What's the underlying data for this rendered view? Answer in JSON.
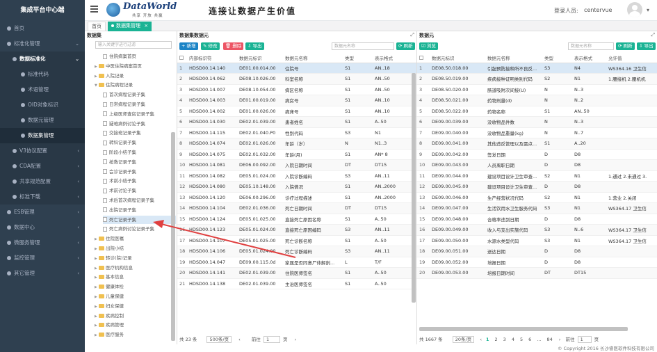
{
  "sidebar": {
    "brand": "集成平台中心端",
    "items": [
      {
        "label": "首页",
        "level": 0,
        "chev": ""
      },
      {
        "label": "标准化管理",
        "level": 0,
        "chev": "⌄"
      },
      {
        "label": "数据标准化",
        "level": 1,
        "chev": "⌄",
        "bold": true
      },
      {
        "label": "标准代码",
        "level": 2,
        "chev": ""
      },
      {
        "label": "术语管理",
        "level": 2,
        "chev": ""
      },
      {
        "label": "OID对象标识",
        "level": 2,
        "chev": ""
      },
      {
        "label": "数据元管理",
        "level": 2,
        "chev": ""
      },
      {
        "label": "数据集管理",
        "level": 2,
        "chev": "",
        "active": true
      },
      {
        "label": "V3协议配置",
        "level": 1,
        "chev": "‹"
      },
      {
        "label": "CDA配置",
        "level": 1,
        "chev": "‹"
      },
      {
        "label": "共享规范配置",
        "level": 1,
        "chev": "‹"
      },
      {
        "label": "标准下载",
        "level": 1,
        "chev": "‹"
      },
      {
        "label": "ESB管理",
        "level": 0,
        "chev": "‹"
      },
      {
        "label": "数据中心",
        "level": 0,
        "chev": "‹"
      },
      {
        "label": "微服务管理",
        "level": 0,
        "chev": "‹"
      },
      {
        "label": "监控管理",
        "level": 0,
        "chev": "‹"
      },
      {
        "label": "其它管理",
        "level": 0,
        "chev": "‹"
      }
    ]
  },
  "header": {
    "menu_icon": "hamburger-icon",
    "logo_text": "DataWorld",
    "logo_sub": "共享 开放 共赢",
    "slogan": "连接让数据产生价值",
    "login_label": "登录人员:",
    "user": "centervue",
    "caret": "▾"
  },
  "tabs": {
    "home": "首页",
    "current": "数据集管理",
    "close": "×"
  },
  "tree": {
    "title": "数据集",
    "search_placeholder": "输入关键字进行过滤",
    "nodes": [
      {
        "label": "住院病案首页",
        "type": "doc",
        "level": 2
      },
      {
        "label": "中医住院病案首页",
        "type": "folder",
        "level": 1
      },
      {
        "label": "入院记录",
        "type": "folder",
        "level": 1
      },
      {
        "label": "住院病程记录",
        "type": "folder",
        "level": 1,
        "open": true
      },
      {
        "label": "首次病程记录子集",
        "type": "doc",
        "level": 2
      },
      {
        "label": "日常病程记录子集",
        "type": "doc",
        "level": 2
      },
      {
        "label": "上级医师查房记录子集",
        "type": "doc",
        "level": 2
      },
      {
        "label": "疑难病例讨论子集",
        "type": "doc",
        "level": 2
      },
      {
        "label": "交接班记录子集",
        "type": "doc",
        "level": 2
      },
      {
        "label": "转科记录子集",
        "type": "doc",
        "level": 2
      },
      {
        "label": "阶段小结子集",
        "type": "doc",
        "level": 2
      },
      {
        "label": "抢救记录子集",
        "type": "doc",
        "level": 2
      },
      {
        "label": "会诊记录子集",
        "type": "doc",
        "level": 2
      },
      {
        "label": "术前小结子集",
        "type": "doc",
        "level": 2
      },
      {
        "label": "术前讨论子集",
        "type": "doc",
        "level": 2
      },
      {
        "label": "术后首次病程记录子集",
        "type": "doc",
        "level": 2
      },
      {
        "label": "出院记录子集",
        "type": "doc",
        "level": 2
      },
      {
        "label": "死亡记录子集",
        "type": "doc",
        "level": 2,
        "selected": true
      },
      {
        "label": "死亡病例讨论记录子集",
        "type": "doc",
        "level": 2
      },
      {
        "label": "住院医嘱",
        "type": "folder",
        "level": 1
      },
      {
        "label": "出院小结",
        "type": "folder",
        "level": 1
      },
      {
        "label": "转诊(院)记录",
        "type": "folder",
        "level": 1
      },
      {
        "label": "医疗机构信息",
        "type": "folder",
        "level": 1
      },
      {
        "label": "基本信息",
        "type": "folder",
        "level": 1
      },
      {
        "label": "健康体检",
        "type": "folder",
        "level": 1
      },
      {
        "label": "儿童保健",
        "type": "folder",
        "level": 1
      },
      {
        "label": "妇女保健",
        "type": "folder",
        "level": 1
      },
      {
        "label": "疾病控制",
        "type": "folder",
        "level": 1
      },
      {
        "label": "疾病管理",
        "type": "folder",
        "level": 1
      },
      {
        "label": "医疗服务",
        "type": "folder",
        "level": 1
      }
    ]
  },
  "middle": {
    "title": "数据集数据元",
    "btn_add": "+ 新增",
    "btn_edit": "✎ 修改",
    "btn_delete": "🗑 删除",
    "btn_export": "⇩ 导出",
    "search_placeholder": "数据元名称",
    "btn_refresh": "⟳ 刷新",
    "columns": [
      "",
      "内部标识符",
      "数据元标识",
      "数据元名称",
      "类型",
      "表示格式"
    ],
    "rows": [
      [
        "1",
        "HDSD00.14.140",
        "DE01.00.014.00",
        "住院号",
        "S1",
        "AN..18"
      ],
      [
        "2",
        "HDSD00.14.062",
        "DE08.10.026.00",
        "科室名称",
        "S1",
        "AN..50"
      ],
      [
        "3",
        "HDSD00.14.007",
        "DE08.10.054.00",
        "病区名称",
        "S1",
        "AN..50"
      ],
      [
        "4",
        "HDSD00.14.003",
        "DE01.00.019.00",
        "病房号",
        "S1",
        "AN..10"
      ],
      [
        "5",
        "HDSD00.14.002",
        "DE01.00.026.00",
        "病床号",
        "S1",
        "AN..10"
      ],
      [
        "6",
        "HDSD00.14.030",
        "DE02.01.039.00",
        "患者姓名",
        "S1",
        "A..50"
      ],
      [
        "7",
        "HDSD00.14.115",
        "DE02.01.040.P0",
        "性别代码",
        "S3",
        "N1"
      ],
      [
        "8",
        "HDSD00.14.074",
        "DE02.01.026.00",
        "年龄（岁）",
        "N",
        "N1..3"
      ],
      [
        "9",
        "HDSD00.14.075",
        "DE02.01.032.00",
        "年龄(月)",
        "S1",
        "AN* 8"
      ],
      [
        "10",
        "HDSD00.14.081",
        "DE06.00.092.00",
        "入院日期时间",
        "DT",
        "DT15"
      ],
      [
        "11",
        "HDSD00.14.082",
        "DE05.01.024.00",
        "入院诊断编码",
        "S3",
        "AN..11"
      ],
      [
        "12",
        "HDSD00.14.080",
        "DE05.10.148.00",
        "入院情况",
        "S1",
        "AN..2000"
      ],
      [
        "13",
        "HDSD00.14.120",
        "DE06.00.296.00",
        "诊疗过程描述",
        "S1",
        "AN..2000"
      ],
      [
        "14",
        "HDSD00.14.104",
        "DE02.01.036.00",
        "死亡日期时间",
        "DT",
        "DT15"
      ],
      [
        "15",
        "HDSD00.14.124",
        "DE05.01.025.00",
        "直接死亡原因名称",
        "S1",
        "A..50"
      ],
      [
        "16",
        "HDSD00.14.123",
        "DE05.01.024.00",
        "直接死亡原因编码",
        "S3",
        "AN..11"
      ],
      [
        "17",
        "HDSD00.14.107",
        "DE05.01.025.00",
        "死亡诊断名称",
        "S1",
        "A..50"
      ],
      [
        "18",
        "HDSD00.14.106",
        "DE05.01.024.00",
        "死亡诊断编码",
        "S3",
        "AN..11"
      ],
      [
        "19",
        "HDSD00.14.047",
        "DE09.00.115.0d",
        "家属是否同意尸体解剖...",
        "L",
        "T/F"
      ],
      [
        "20",
        "HDSD00.14.141",
        "DE02.01.039.00",
        "住院医师签名",
        "S1",
        "A..50"
      ],
      [
        "21",
        "HDSD00.14.138",
        "DE02.01.039.00",
        "主治医师签名",
        "S1",
        "A..50"
      ]
    ],
    "pager": {
      "total": "共 23 条",
      "page_size": "500条/页",
      "prev": "‹",
      "goto": "前往",
      "page": "1",
      "unit": "页",
      "next": "›"
    }
  },
  "right": {
    "title": "数据元",
    "btn_browse": "浏览",
    "search_placeholder": "数据元名称",
    "btn_refresh": "⟳ 刷新",
    "btn_export": "⇩ 导出",
    "columns": [
      "",
      "数据元标识",
      "数据元名称",
      "类型",
      "表示格式",
      "允许值"
    ],
    "rows": [
      [
        "1",
        "DE08.50.018.00",
        "引起预防接种所不良反...",
        "S3",
        "N4",
        "WS364.16 卫生信"
      ],
      [
        "2",
        "DE08.50.019.00",
        "疾病接种证明类别代码",
        "S2",
        "N1",
        "1.腰接机 2.腰机机"
      ],
      [
        "3",
        "DE08.50.020.00",
        "肠道吸附次间接(U)",
        "N",
        "N..3",
        ""
      ],
      [
        "4",
        "DE08.50.021.00",
        "药物剂量(d)",
        "N",
        "N..2",
        ""
      ],
      [
        "5",
        "DE08.50.022.00",
        "药物名称",
        "S1",
        "AN..50",
        ""
      ],
      [
        "6",
        "DE09.00.039.00",
        "没收物品件数",
        "N",
        "N..3",
        ""
      ],
      [
        "7",
        "DE09.00.040.00",
        "没收物品重量(kg)",
        "N",
        "N..7",
        ""
      ],
      [
        "8",
        "DE09.00.041.00",
        "其他违反管理以及需点...",
        "S1",
        "A..20",
        ""
      ],
      [
        "9",
        "DE09.00.042.00",
        "签发日期",
        "D",
        "D8",
        ""
      ],
      [
        "10",
        "DE09.00.043.00",
        "人员离职日期",
        "D",
        "D8",
        ""
      ],
      [
        "11",
        "DE09.00.044.00",
        "建设项目设计卫生审查...",
        "S2",
        "N1",
        "1.通过 2.未通过 3."
      ],
      [
        "12",
        "DE09.00.045.00",
        "建设项目设计卫生审查...",
        "D",
        "D8",
        ""
      ],
      [
        "13",
        "DE09.00.046.00",
        "生产经营状况代码",
        "S2",
        "N1",
        "1.营业 2.关闭"
      ],
      [
        "14",
        "DE09.00.047.00",
        "生活饮用水卫生服务代码",
        "S3",
        "N1",
        "WS364.17 卫生信"
      ],
      [
        "15",
        "DE09.00.048.00",
        "合格率违到日期",
        "D",
        "D8",
        ""
      ],
      [
        "16",
        "DE09.00.049.00",
        "收入与支出实施代码",
        "S3",
        "N..6",
        "WS364.17 卫生信"
      ],
      [
        "17",
        "DE09.00.050.00",
        "水源水类型代码",
        "S3",
        "N1",
        "WS364.17 卫生信"
      ],
      [
        "18",
        "DE09.00.051.00",
        "送达日期",
        "D",
        "D8",
        ""
      ],
      [
        "19",
        "DE09.00.052.00",
        "培报日期",
        "D",
        "D8",
        ""
      ],
      [
        "20",
        "DE09.00.053.00",
        "培报日期时间",
        "DT",
        "DT15",
        ""
      ]
    ],
    "pager": {
      "total": "共 1667 条",
      "page_size": "20条/页",
      "prev": "‹",
      "pages": [
        "1",
        "2",
        "3",
        "4",
        "5",
        "6",
        "...",
        "84"
      ],
      "next": "›",
      "goto": "前往",
      "page": "1",
      "unit": "页"
    }
  },
  "footer": "© Copyright 2016 长沙睿医软件科技有限公司",
  "colors": {
    "sidebar": "#2f4050",
    "accent": "#1ab394",
    "danger": "#ed5565",
    "primary": "#1c84c6",
    "selected": "#d9e8f6",
    "arrow": "#e04040"
  }
}
